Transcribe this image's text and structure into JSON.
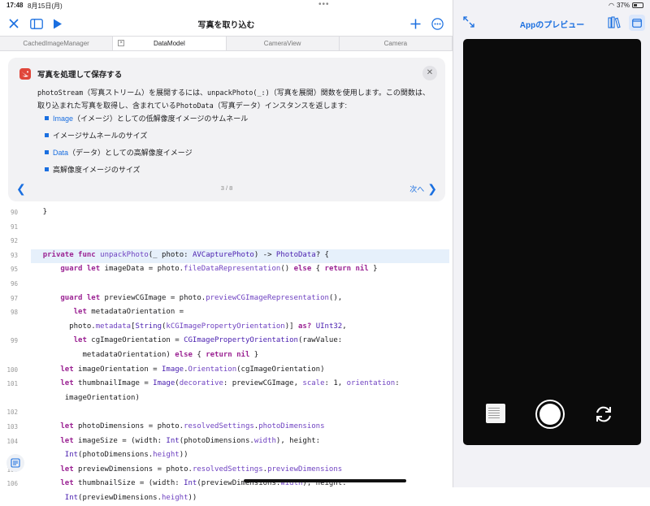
{
  "status": {
    "time": "17:48",
    "date": "8月15日(月)",
    "battery": "37%"
  },
  "toolbar": {
    "title": "写真を取り込む"
  },
  "tabs": [
    {
      "label": "CachedImageManager"
    },
    {
      "label": "DataModel"
    },
    {
      "label": "CameraView"
    },
    {
      "label": "Camera"
    }
  ],
  "tip": {
    "title": "写真を処理して保存する",
    "body_part1": "photoStream",
    "body_part2": "（写真ストリーム）を展開するには、",
    "body_part3": "unpackPhoto(_:)",
    "body_part4": "（写真を展開）関数を使用します。この関数は、取り込まれた写真を取得し、含まれている",
    "body_part5": "PhotoData",
    "body_part6": "（写真データ）インスタンスを返します:",
    "items": [
      {
        "link": "Image",
        "text": "（イメージ）としての低解像度イメージのサムネール"
      },
      {
        "link": "",
        "text": "イメージサムネールのサイズ"
      },
      {
        "link": "Data",
        "text": "（データ）としての高解像度イメージ"
      },
      {
        "link": "",
        "text": "高解像度イメージのサイズ"
      }
    ],
    "page": "3 / 8",
    "next_label": "次へ"
  },
  "code_lines": [
    {
      "num": "90",
      "text": "    }"
    },
    {
      "num": "91",
      "text": ""
    },
    {
      "num": "92",
      "text": ""
    },
    {
      "num": "93",
      "text": "    private func unpackPhoto(_ photo: AVCapturePhoto) -> PhotoData? {"
    },
    {
      "num": "95",
      "text": "        guard let imageData = photo.fileDataRepresentation() else { return nil }"
    },
    {
      "num": "96",
      "text": ""
    },
    {
      "num": "97",
      "text": "        guard let previewCGImage = photo.previewCGImageRepresentation(),"
    },
    {
      "num": "98",
      "text": "           let metadataOrientation ="
    },
    {
      "num": "",
      "text": "          photo.metadata[String(kCGImagePropertyOrientation)] as? UInt32,"
    },
    {
      "num": "99",
      "text": "           let cgImageOrientation = CGImagePropertyOrientation(rawValue:"
    },
    {
      "num": "",
      "text": "             metadataOrientation) else { return nil }"
    },
    {
      "num": "100",
      "text": "        let imageOrientation = Image.Orientation(cgImageOrientation)"
    },
    {
      "num": "101",
      "text": "        let thumbnailImage = Image(decorative: previewCGImage, scale: 1, orientation:"
    },
    {
      "num": "",
      "text": "         imageOrientation)"
    },
    {
      "num": "102",
      "text": ""
    },
    {
      "num": "103",
      "text": "        let photoDimensions = photo.resolvedSettings.photoDimensions"
    },
    {
      "num": "104",
      "text": "        let imageSize = (width: Int(photoDimensions.width), height:"
    },
    {
      "num": "",
      "text": "         Int(photoDimensions.height))"
    },
    {
      "num": "105",
      "text": "        let previewDimensions = photo.resolvedSettings.previewDimensions"
    },
    {
      "num": "106",
      "text": "        let thumbnailSize = (width: Int(previewDimensions.width), height:"
    },
    {
      "num": "",
      "text": "         Int(previewDimensions.height))"
    }
  ],
  "preview": {
    "title": "Appのプレビュー"
  }
}
